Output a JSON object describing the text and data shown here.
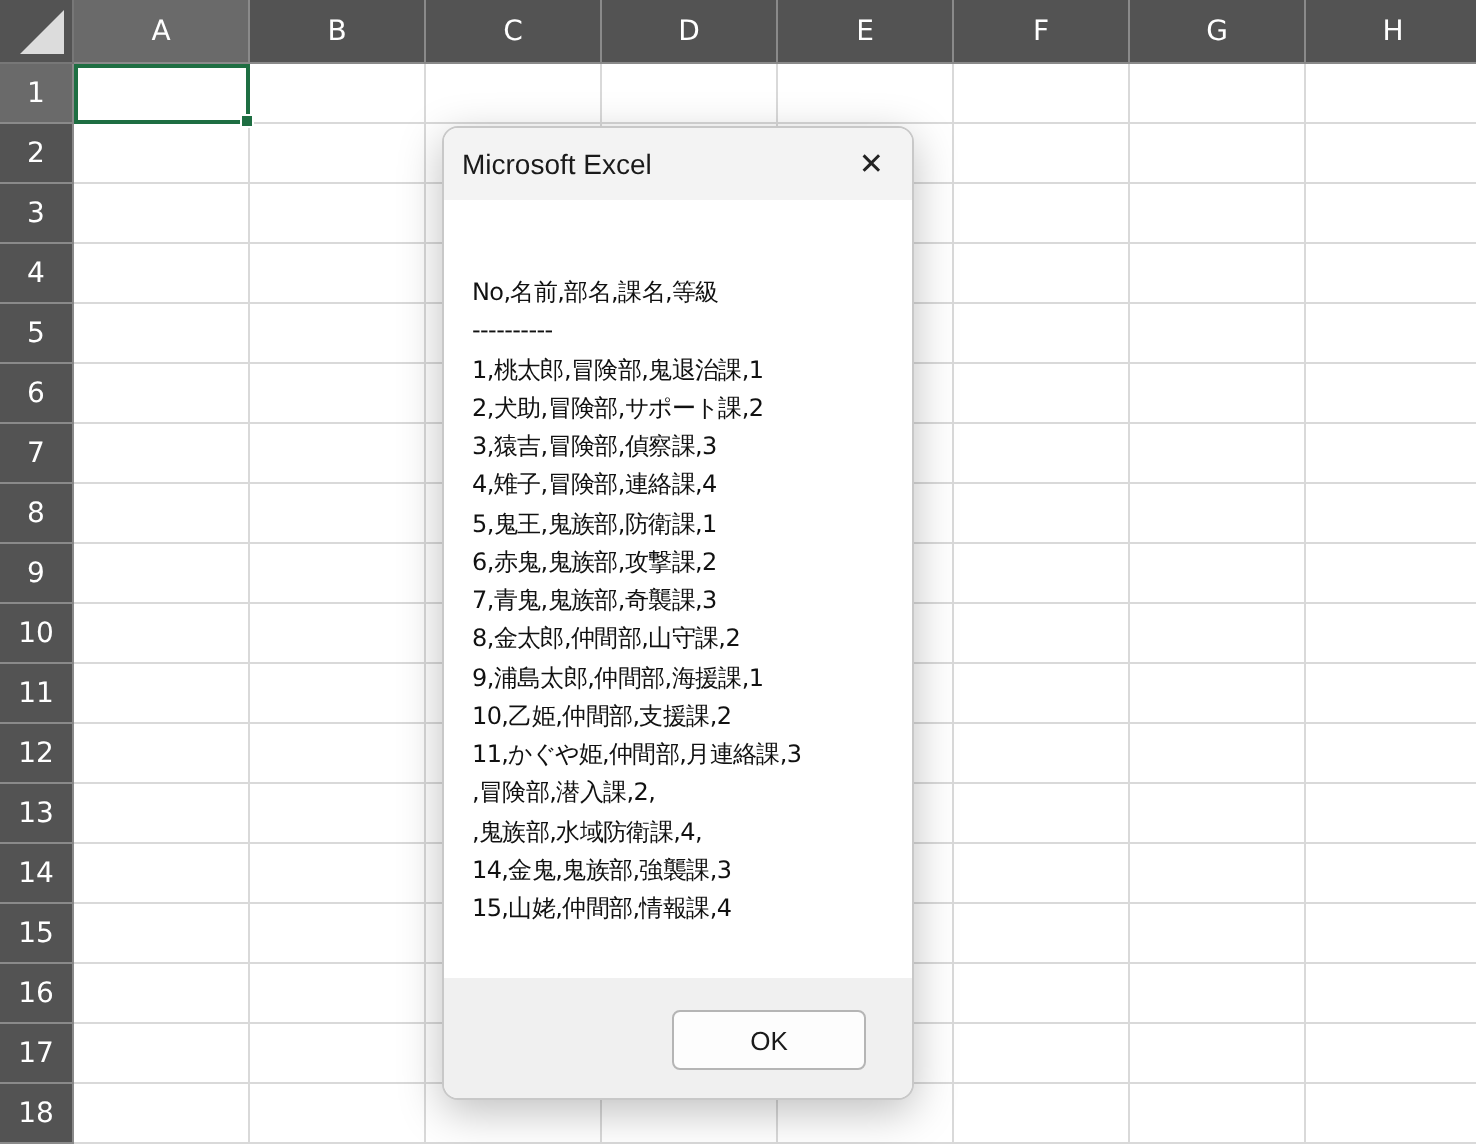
{
  "sheet": {
    "columns": [
      {
        "label": "A",
        "selected": true
      },
      {
        "label": "B",
        "selected": false
      },
      {
        "label": "C",
        "selected": false
      },
      {
        "label": "D",
        "selected": false
      },
      {
        "label": "E",
        "selected": false
      },
      {
        "label": "F",
        "selected": false
      },
      {
        "label": "G",
        "selected": false
      },
      {
        "label": "H",
        "selected": false
      }
    ],
    "rows": [
      {
        "label": "1",
        "selected": true
      },
      {
        "label": "2",
        "selected": false
      },
      {
        "label": "3",
        "selected": false
      },
      {
        "label": "4",
        "selected": false
      },
      {
        "label": "5",
        "selected": false
      },
      {
        "label": "6",
        "selected": false
      },
      {
        "label": "7",
        "selected": false
      },
      {
        "label": "8",
        "selected": false
      },
      {
        "label": "9",
        "selected": false
      },
      {
        "label": "10",
        "selected": false
      },
      {
        "label": "11",
        "selected": false
      },
      {
        "label": "12",
        "selected": false
      },
      {
        "label": "13",
        "selected": false
      },
      {
        "label": "14",
        "selected": false
      },
      {
        "label": "15",
        "selected": false
      },
      {
        "label": "16",
        "selected": false
      },
      {
        "label": "17",
        "selected": false
      },
      {
        "label": "18",
        "selected": false
      }
    ]
  },
  "dialog": {
    "title": "Microsoft Excel",
    "close": "✕",
    "message": [
      "No,名前,部名,課名,等級",
      "----------",
      "1,桃太郎,冒険部,鬼退治課,1",
      "2,犬助,冒険部,サポート課,2",
      "3,猿吉,冒険部,偵察課,3",
      "4,雉子,冒険部,連絡課,4",
      "5,鬼王,鬼族部,防衛課,1",
      "6,赤鬼,鬼族部,攻撃課,2",
      "7,青鬼,鬼族部,奇襲課,3",
      "8,金太郎,仲間部,山守課,2",
      "9,浦島太郎,仲間部,海援課,1",
      "10,乙姫,仲間部,支援課,2",
      "11,かぐや姫,仲間部,月連絡課,3",
      ",冒険部,潜入課,2,",
      ",鬼族部,水域防衛課,4,",
      "14,金鬼,鬼族部,強襲課,3",
      "15,山姥,仲間部,情報課,4"
    ],
    "buttons": [
      "OK"
    ]
  }
}
